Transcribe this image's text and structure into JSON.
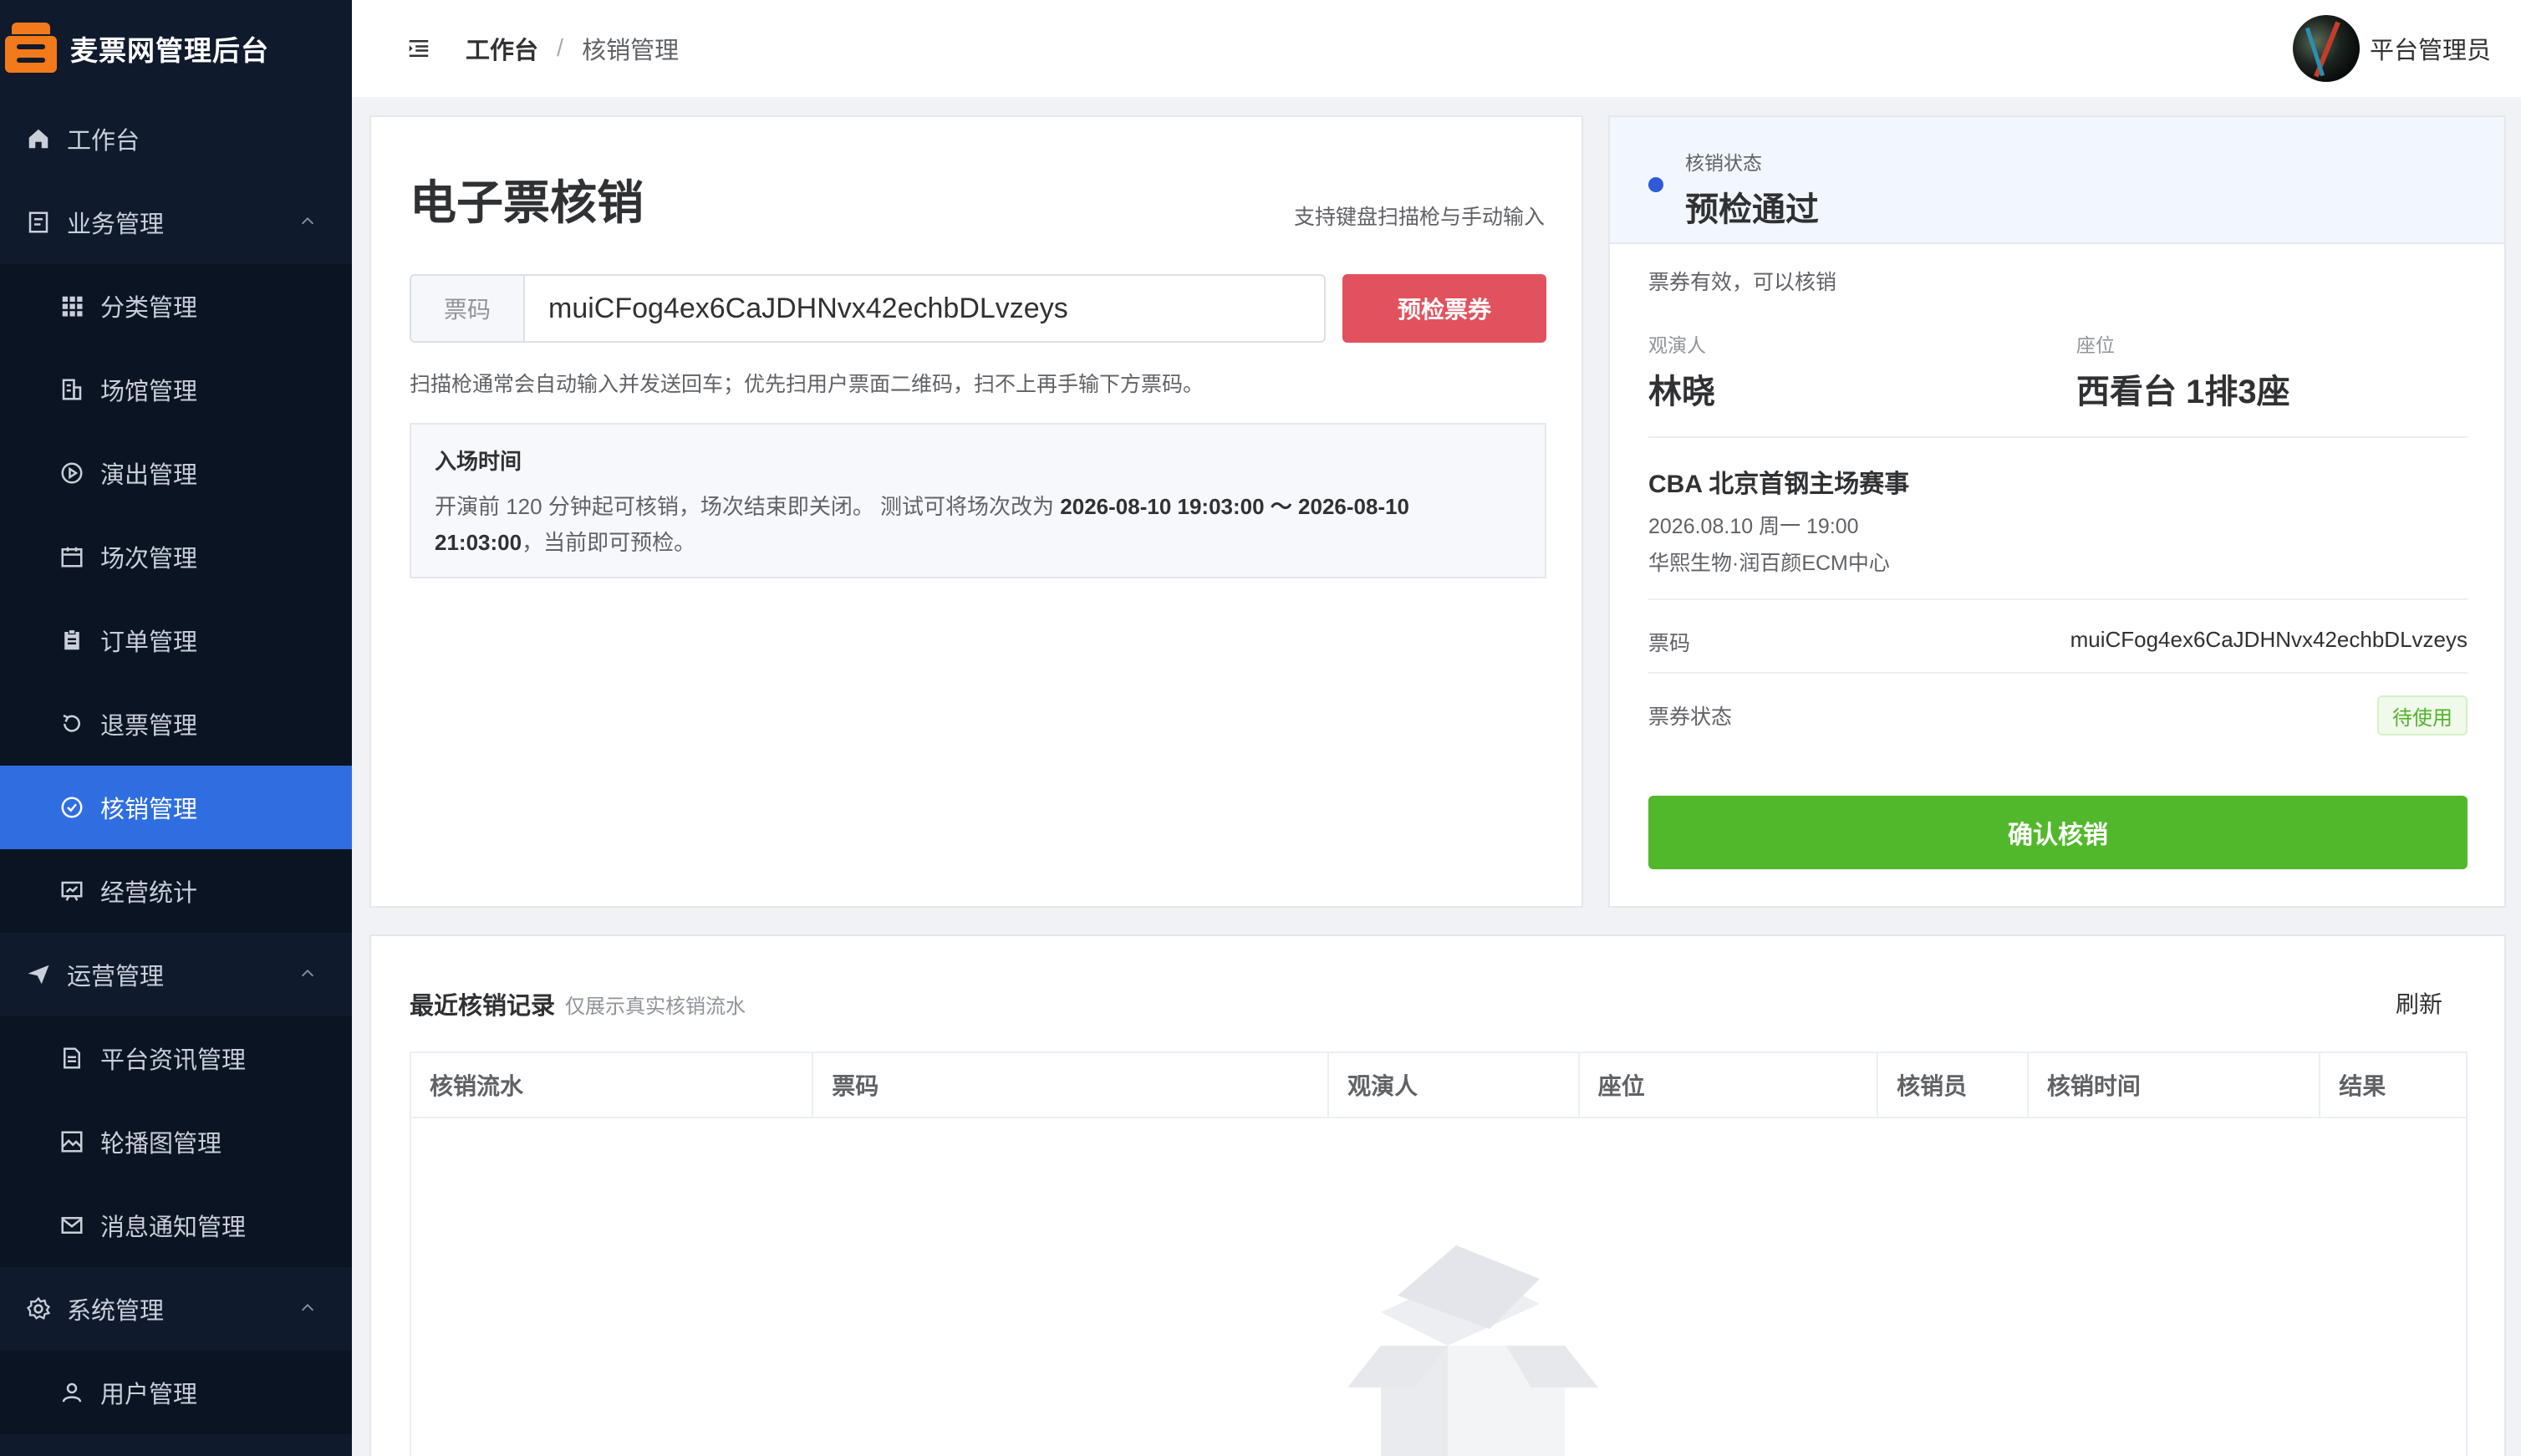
{
  "app": {
    "title": "麦票网管理后台"
  },
  "sidebar": {
    "items": [
      {
        "label": "工作台",
        "icon": "home-icon",
        "level": "top"
      },
      {
        "label": "业务管理",
        "icon": "document-icon",
        "level": "top",
        "expanded": true
      },
      {
        "label": "分类管理",
        "icon": "grid-icon",
        "level": "sub"
      },
      {
        "label": "场馆管理",
        "icon": "building-icon",
        "level": "sub"
      },
      {
        "label": "演出管理",
        "icon": "play-circle-icon",
        "level": "sub"
      },
      {
        "label": "场次管理",
        "icon": "calendar-icon",
        "level": "sub"
      },
      {
        "label": "订单管理",
        "icon": "clipboard-icon",
        "level": "sub"
      },
      {
        "label": "退票管理",
        "icon": "refresh-icon",
        "level": "sub"
      },
      {
        "label": "核销管理",
        "icon": "check-circle-icon",
        "level": "sub",
        "active": true
      },
      {
        "label": "经营统计",
        "icon": "chart-board-icon",
        "level": "sub"
      },
      {
        "label": "运营管理",
        "icon": "send-icon",
        "level": "top",
        "expanded": true
      },
      {
        "label": "平台资讯管理",
        "icon": "news-icon",
        "level": "sub"
      },
      {
        "label": "轮播图管理",
        "icon": "image-icon",
        "level": "sub"
      },
      {
        "label": "消息通知管理",
        "icon": "mail-icon",
        "level": "sub"
      },
      {
        "label": "系统管理",
        "icon": "gear-icon",
        "level": "top",
        "expanded": true
      },
      {
        "label": "用户管理",
        "icon": "user-icon",
        "level": "sub"
      }
    ]
  },
  "header": {
    "breadcrumb": [
      "工作台",
      "核销管理"
    ],
    "user_name": "平台管理员"
  },
  "verify": {
    "title": "电子票核销",
    "hint": "支持键盘扫描枪与手动输入",
    "input_prefix": "票码",
    "input_value": "muiCFog4ex6CaJDHNvx42echbDLvzeys",
    "precheck_label": "预检票券",
    "scan_tip": "扫描枪通常会自动输入并发送回车；优先扫用户票面二维码，扫不上再手输下方票码。",
    "entry_title": "入场时间",
    "entry_text_prefix": "开演前 120 分钟起可核销，场次结束即关闭。 测试可将场次改为 ",
    "entry_range": "2026-08-10 19:03:00 ～ 2026-08-10 21:03:00",
    "entry_text_suffix": "，当前即可预检。"
  },
  "status": {
    "label": "核销状态",
    "value": "预检通过",
    "valid_text": "票券有效，可以核销",
    "viewer_label": "观演人",
    "viewer": "林晓",
    "seat_label": "座位",
    "seat": "西看台 1排3座",
    "event_title": "CBA 北京首钢主场赛事",
    "event_time": "2026.08.10 周一 19:00",
    "event_venue": "华熙生物·润百颜ECM中心",
    "code_label": "票码",
    "code_value": "muiCFog4ex6CaJDHNvx42echbDLvzeys",
    "ticket_status_label": "票券状态",
    "ticket_status": "待使用",
    "confirm_label": "确认核销",
    "colors": {
      "accent": "#2f5bd9",
      "success": "#52b82b",
      "danger": "#e2525e"
    }
  },
  "records": {
    "title": "最近核销记录",
    "subtitle": "仅展示真实核销流水",
    "refresh_label": "刷新",
    "columns": [
      "核销流水",
      "票码",
      "观演人",
      "座位",
      "核销员",
      "核销时间",
      "结果"
    ],
    "rows": []
  }
}
